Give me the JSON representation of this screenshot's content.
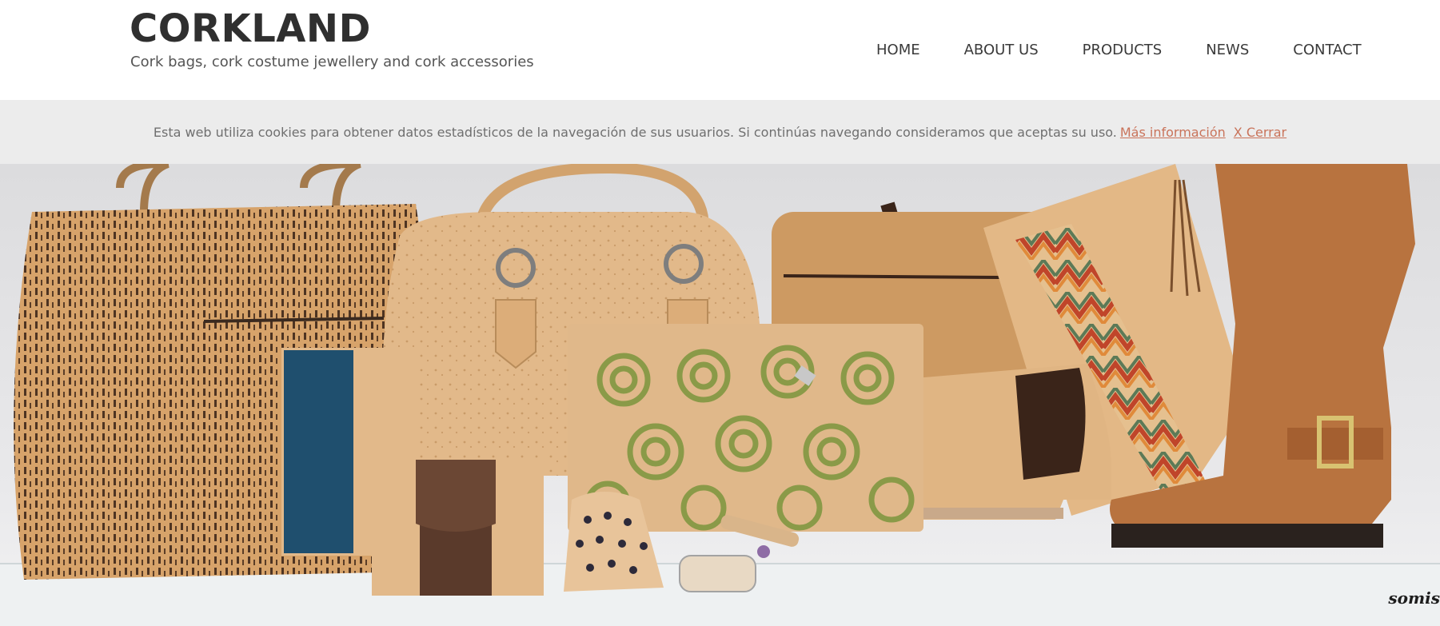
{
  "header": {
    "title": "CORKLAND",
    "tagline": "Cork bags, cork costume jewellery and cork accessories"
  },
  "nav": {
    "items": [
      {
        "label": "HOME"
      },
      {
        "label": "ABOUT US"
      },
      {
        "label": "PRODUCTS"
      },
      {
        "label": "NEWS"
      },
      {
        "label": "CONTACT"
      }
    ]
  },
  "cookie_bar": {
    "message": "Esta web utiliza cookies para obtener datos estadísticos de la navegación de sus usuarios. Si continúas navegando consideramos que aceptas su uso.",
    "more_info": "Más información",
    "close": "X Cerrar"
  },
  "hero": {
    "watermark": "somis"
  },
  "colors": {
    "link": "#c9735a",
    "cookie_bg": "#ececec",
    "cork_light": "#e2b98a",
    "cork_dark": "#b98a55",
    "denim": "#1f4f6e",
    "boot": "#b8733f"
  }
}
